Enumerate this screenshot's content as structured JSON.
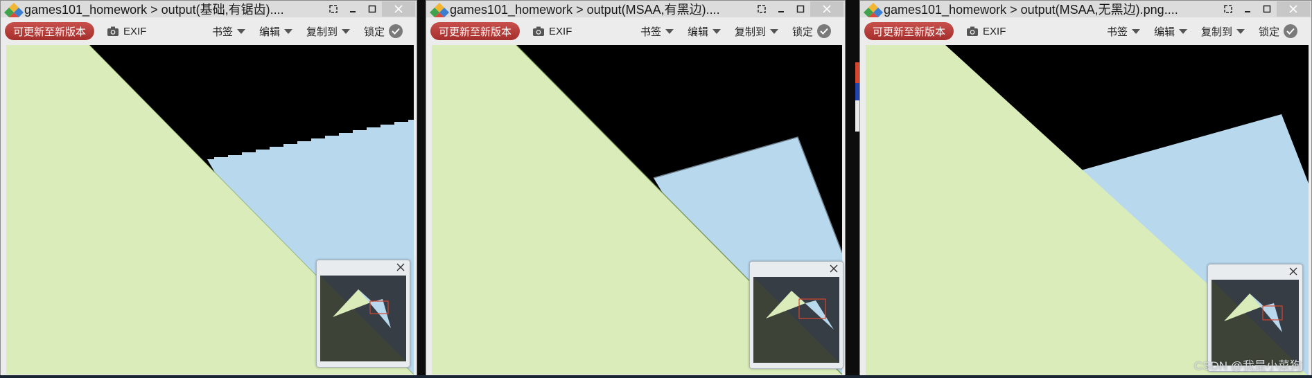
{
  "windows": [
    {
      "title": "games101_homework > output(基础,有锯齿)....",
      "variant": "jagged"
    },
    {
      "title": "games101_homework > output(MSAA,有黑边)....",
      "variant": "msaa-black"
    },
    {
      "title": "games101_homework > output(MSAA,无黑边).png....",
      "variant": "msaa-clean"
    }
  ],
  "toolbar": {
    "update_label": "可更新至新版本",
    "exif_label": "EXIF",
    "bookmark_label": "书签",
    "edit_label": "编辑",
    "copyto_label": "复制到",
    "lock_label": "锁定"
  },
  "colors": {
    "triangle_green": "#d9ecb9",
    "triangle_blue": "#b8d8ee",
    "canvas_bg": "#000000",
    "update_button": "#b53a36"
  },
  "watermark": "CSDN @我是小菜狗"
}
